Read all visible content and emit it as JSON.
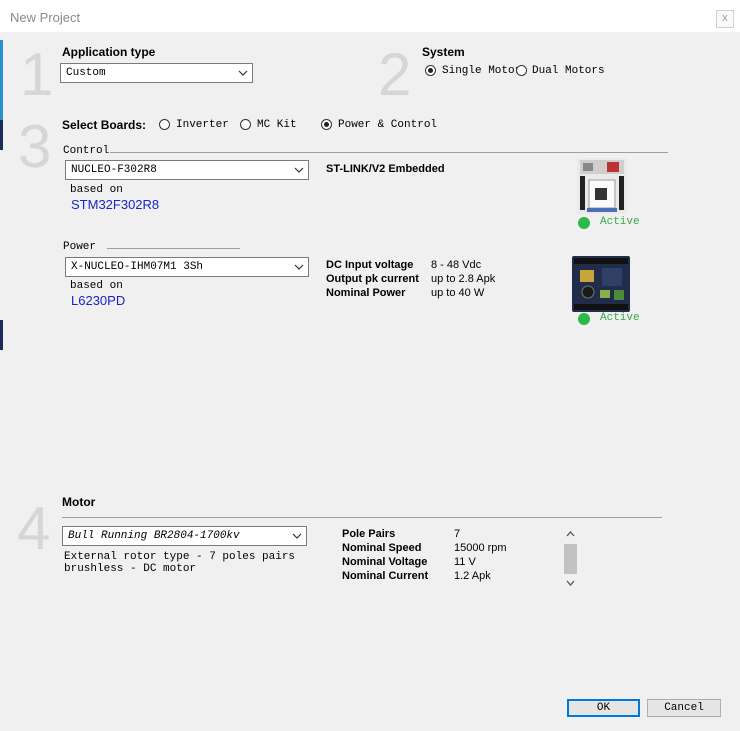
{
  "window": {
    "title": "New Project",
    "close_glyph": "x"
  },
  "steps": {
    "one": "1",
    "two": "2",
    "three": "3",
    "four": "4"
  },
  "application_type": {
    "label": "Application type",
    "value": "Custom"
  },
  "system": {
    "label": "System",
    "options": [
      {
        "label": "Single Motor",
        "selected": true
      },
      {
        "label": "Dual Motors",
        "selected": false
      }
    ]
  },
  "select_boards": {
    "label": "Select Boards:",
    "options": [
      {
        "label": "Inverter",
        "selected": false
      },
      {
        "label": "MC Kit",
        "selected": false
      },
      {
        "label": "Power & Control",
        "selected": true
      }
    ]
  },
  "control": {
    "group_label": "Control",
    "board_value": "NUCLEO-F302R8",
    "based_on_label": "based on",
    "based_on_value": "STM32F302R8",
    "info": "ST-LINK/V2 Embedded",
    "status": "Active"
  },
  "power": {
    "group_label": "Power",
    "board_value": "X-NUCLEO-IHM07M1 3Sh",
    "based_on_label": "based on",
    "based_on_value": "L6230PD",
    "specs": [
      {
        "key": "DC Input voltage",
        "value": "8 - 48 Vdc"
      },
      {
        "key": "Output pk current",
        "value": "up to 2.8 Apk"
      },
      {
        "key": "Nominal Power",
        "value": "up to 40 W"
      }
    ],
    "status": "Active"
  },
  "motor": {
    "label": "Motor",
    "value": "Bull Running BR2804-1700kv",
    "description_line1": "External rotor type - 7 poles pairs",
    "description_line2": "brushless - DC motor",
    "specs": [
      {
        "key": "Pole Pairs",
        "value": "7"
      },
      {
        "key": "Nominal Speed",
        "value": "15000 rpm"
      },
      {
        "key": "Nominal Voltage",
        "value": "11 V"
      },
      {
        "key": "Nominal Current",
        "value": "1.2 Apk"
      }
    ]
  },
  "buttons": {
    "ok": "OK",
    "cancel": "Cancel"
  },
  "colors": {
    "accent": "#0078d7",
    "active": "#2db84a",
    "link": "#1a24c8"
  }
}
